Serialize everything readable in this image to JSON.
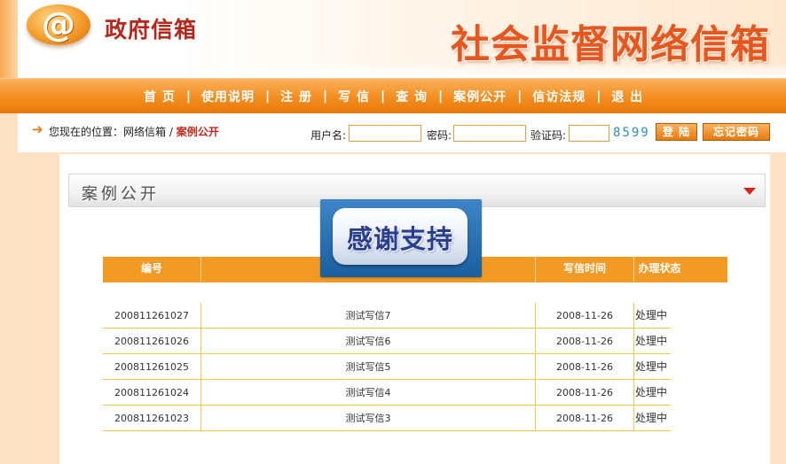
{
  "header": {
    "logo_symbol": "@",
    "site_name": "政府信箱",
    "banner_title": "社会监督网络信箱"
  },
  "nav": {
    "items": [
      {
        "label": "首 页"
      },
      {
        "label": "使用说明"
      },
      {
        "label": "注 册"
      },
      {
        "label": "写 信"
      },
      {
        "label": "查 询"
      },
      {
        "label": "案例公开"
      },
      {
        "label": "信访法规"
      },
      {
        "label": "退 出"
      }
    ],
    "separator": "|"
  },
  "breadcrumb": {
    "prefix": "您现在的位置：网络信箱",
    "divider": "/",
    "current": "案例公开"
  },
  "login": {
    "username_label": "用户名:",
    "username_value": "",
    "password_label": "密码:",
    "password_value": "",
    "captcha_label": "验证码:",
    "captcha_value": "",
    "captcha_code": "8599",
    "login_button": "登 陆",
    "forgot_button": "忘记密码"
  },
  "section": {
    "title": "案例公开"
  },
  "overlay": {
    "text": "感谢支持"
  },
  "table": {
    "headers": [
      "编号",
      "",
      "写信时间",
      "办理状态"
    ],
    "rows": [
      {
        "id": "200811261027",
        "title": "测试写信7",
        "date": "2008-11-26",
        "status": "处理中"
      },
      {
        "id": "200811261026",
        "title": "测试写信6",
        "date": "2008-11-26",
        "status": "处理中"
      },
      {
        "id": "200811261025",
        "title": "测试写信5",
        "date": "2008-11-26",
        "status": "处理中"
      },
      {
        "id": "200811261024",
        "title": "测试写信4",
        "date": "2008-11-26",
        "status": "处理中"
      },
      {
        "id": "200811261023",
        "title": "测试写信3",
        "date": "2008-11-26",
        "status": "处理中"
      }
    ]
  },
  "colors": {
    "accent_orange": "#f28d1f",
    "banner_red": "#e5571e",
    "brand_red": "#b5271a",
    "row_border": "#f4c84a"
  }
}
